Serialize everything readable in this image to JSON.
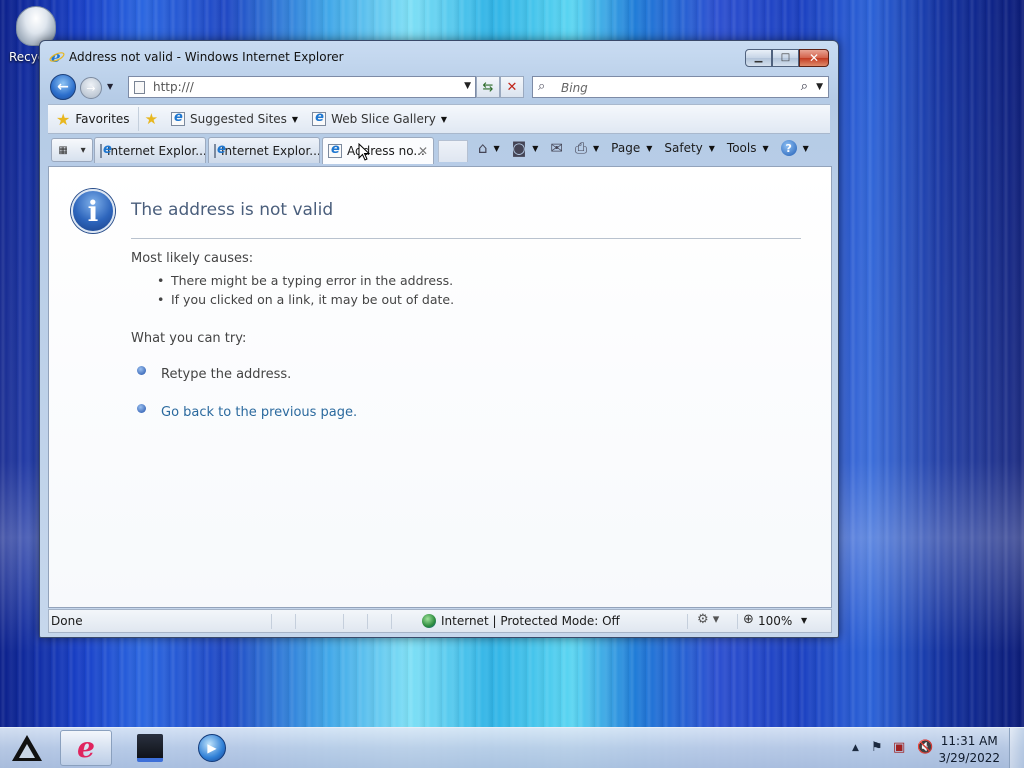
{
  "desktop": {
    "recycle_label": "Recyc"
  },
  "window": {
    "title": "Address not valid - Windows Internet Explorer",
    "address": "http:///",
    "search_placeholder": "Bing"
  },
  "favorites_bar": {
    "favorites_label": "Favorites",
    "items": [
      "Suggested Sites",
      "Web Slice Gallery"
    ]
  },
  "tabs": [
    {
      "label": "Internet Explor..."
    },
    {
      "label": "Internet Explor..."
    },
    {
      "label": "Address no..."
    }
  ],
  "command_bar": {
    "page": "Page",
    "safety": "Safety",
    "tools": "Tools"
  },
  "content": {
    "title": "The address is not valid",
    "causes_heading": "Most likely causes:",
    "causes": [
      "There might be a typing error in the address.",
      "If you clicked on a link, it may be out of date."
    ],
    "try_heading": "What you can try:",
    "actions": [
      "Retype the address.",
      "Go back to the previous page."
    ]
  },
  "status": {
    "text": "Done",
    "zone": "Internet | Protected Mode: Off",
    "zoom": "100%"
  },
  "taskbar": {
    "time": "11:31 AM",
    "date": "3/29/2022"
  }
}
